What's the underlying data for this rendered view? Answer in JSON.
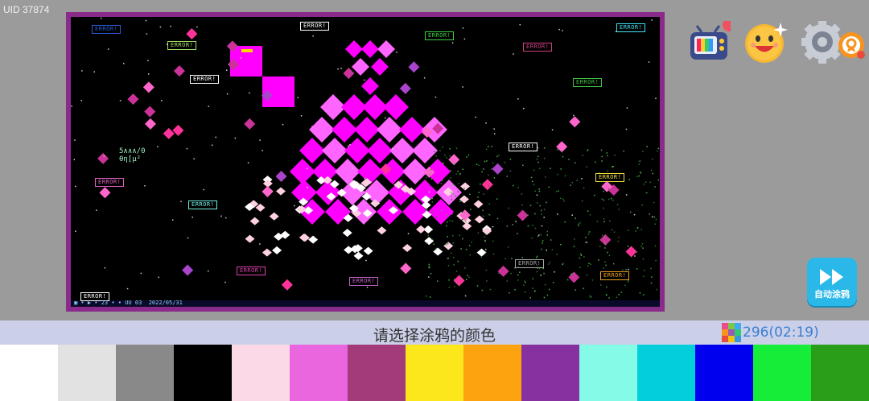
{
  "uid_label": "UID 37874",
  "canvas": {
    "error_label": "ERROR!",
    "doodle_text": "5∧∧∧/0\nθη[μ²",
    "status_line": "▣ • ▶ • 23 • • UU 03  2022/05/31",
    "errors": [
      {
        "color": "#2a5cd8"
      },
      {
        "color": "#a0e060"
      },
      {
        "color": "#ffffff"
      },
      {
        "color": "#ffffff"
      },
      {
        "color": "#40d040"
      },
      {
        "color": "#d04080"
      },
      {
        "color": "#40e0f0"
      },
      {
        "color": "#40c040"
      },
      {
        "color": "#ffffff"
      },
      {
        "color": "#f0e040"
      },
      {
        "color": "#e060c0"
      },
      {
        "color": "#70f0e0"
      },
      {
        "color": "#e040b0"
      },
      {
        "color": "#c060c0"
      },
      {
        "color": "#aaaaaa"
      },
      {
        "color": "#f0a020"
      },
      {
        "color": "#ffffff"
      }
    ]
  },
  "top_icons": {
    "tv": "tv-icon",
    "face": "smiley-icon",
    "settings": "gear-icon",
    "badge": "ribbon-badge-icon"
  },
  "auto_button": {
    "label": "自动涂鸦",
    "icon": "fast-forward-icon"
  },
  "prompt": {
    "text": "请选择涂鸦的颜色",
    "counter": "296(02:19)",
    "counter_icon_colors": [
      "#e84c8a",
      "#7ac943",
      "#3fa9f5",
      "#f7931e",
      "#9b59b6",
      "#2ecc71",
      "#e74c3c",
      "#f1c40f",
      "#3498db"
    ]
  },
  "palette": [
    "#ffffff",
    "#e2e2e2",
    "#898989",
    "#000000",
    "#fbd9e6",
    "#ea66de",
    "#a33a7a",
    "#fce71c",
    "#fda30f",
    "#8731a1",
    "#85fae6",
    "#03cfda",
    "#0000ee",
    "#15ed38",
    "#2a9e19"
  ]
}
